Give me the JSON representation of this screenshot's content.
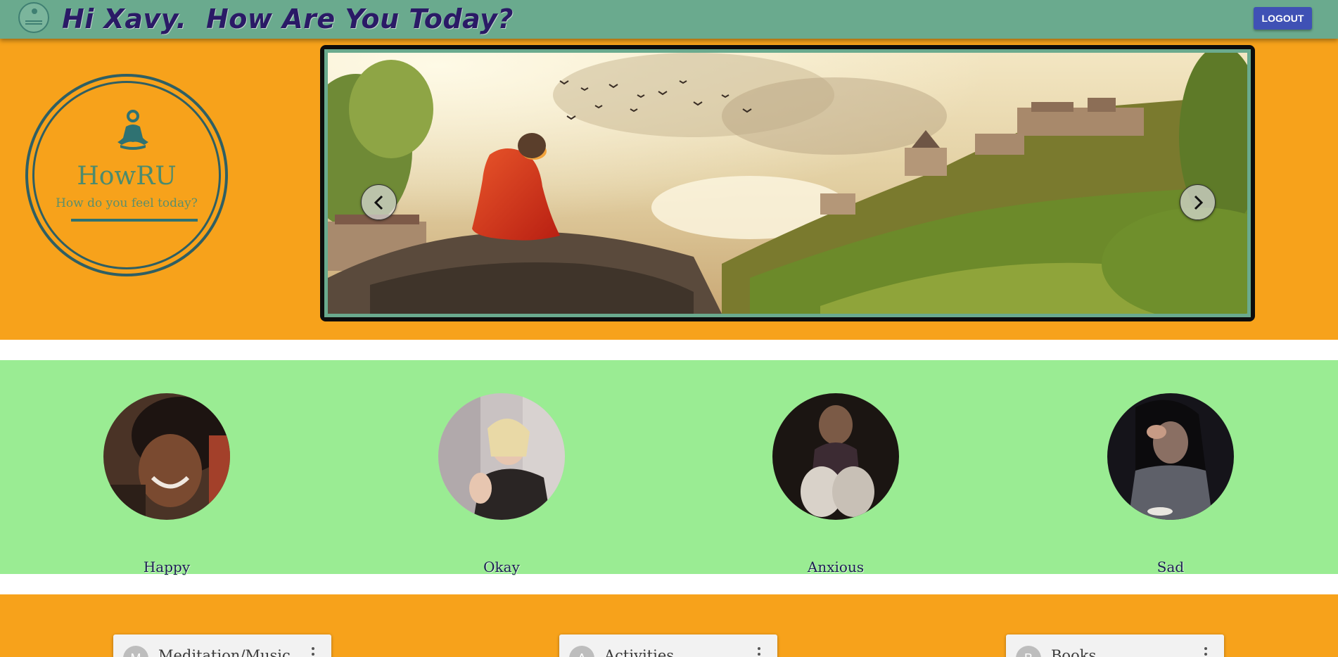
{
  "header": {
    "title": "Hi Xavy.  How Are You Today?",
    "logout_label": "LOGOUT",
    "logo_icon": "meditation-logo-icon"
  },
  "badge": {
    "icon": "meditation-icon",
    "title": "HowRU",
    "subtitle": "How do you feel today?"
  },
  "carousel": {
    "image": "monk-meditating-on-cliff",
    "prev_icon": "chevron-left-icon",
    "next_icon": "chevron-right-icon"
  },
  "moods": [
    {
      "label": "Happy"
    },
    {
      "label": "Okay"
    },
    {
      "label": "Anxious"
    },
    {
      "label": "Sad"
    }
  ],
  "cards": [
    {
      "avatar": "M",
      "title": "Meditation/Music",
      "menu_icon": "more-vert-icon"
    },
    {
      "avatar": "A",
      "title": "Activities",
      "menu_icon": "more-vert-icon"
    },
    {
      "avatar": "B",
      "title": "Books",
      "menu_icon": "more-vert-icon"
    }
  ],
  "colors": {
    "header": "#6aaa8e",
    "hero": "#f7a21b",
    "moods": "#9aec93",
    "logout_button": "#3f51b5",
    "title_text": "#2a1a66"
  }
}
